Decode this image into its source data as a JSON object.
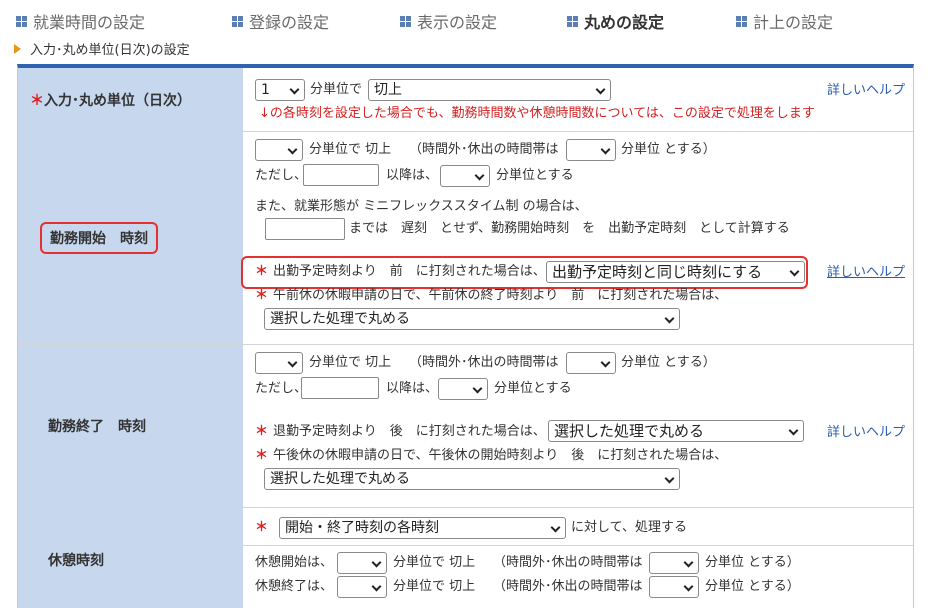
{
  "tabs": [
    {
      "label": "就業時間の設定"
    },
    {
      "label": "登録の設定"
    },
    {
      "label": "表示の設定"
    },
    {
      "label": "丸めの設定"
    },
    {
      "label": "計上の設定"
    }
  ],
  "breadcrumb": "入力･丸め単位(日次)の設定",
  "required_mark": "＊",
  "colors": {
    "accent": "#2f63b0",
    "label_bg": "#c6d7ee",
    "highlight": "#e53030",
    "required": "#e02020",
    "link": "#2a5db0"
  },
  "row_input_unit": {
    "label": "入力･丸め単位（日次）",
    "unit_select": "1",
    "unit_text": "分単位で",
    "method_select": "切上",
    "help_link": "詳しいヘルプ",
    "note": "↓の各時刻を設定した場合でも、勤務時間数や休憩時間数については、この設定で処理をします"
  },
  "row_start": {
    "label": "勤務開始　時刻",
    "line1_unit": "分単位で",
    "line1_method": "切上",
    "line1_mid": "（時間外･休出の時間帯は",
    "line1_end": "分単位 とする）",
    "line2_pre": "ただし、",
    "line2_mid": "以降は、",
    "line2_end": "分単位とする",
    "flex_line": "また、就業形態が ミニフレックススタイム制 の場合は、",
    "flex_line2": "までは　遅刻　とせず、勤務開始時刻　を　出勤予定時刻　として計算する",
    "before_label": "出勤予定時刻より　前　に打刻された場合は、",
    "before_select": "出勤予定時刻と同じ時刻にする",
    "help_link": "詳しいヘルプ",
    "am_leave_label": "午前休の休暇申請の日で、午前休の終了時刻より　前　に打刻された場合は、",
    "am_leave_select": "選択した処理で丸める"
  },
  "row_end": {
    "label": "勤務終了　時刻",
    "line1_unit": "分単位で",
    "line1_method": "切上",
    "line1_mid": "（時間外･休出の時間帯は",
    "line1_end": "分単位 とする）",
    "line2_pre": "ただし、",
    "line2_mid": "以降は、",
    "line2_end": "分単位とする",
    "after_label": "退勤予定時刻より　後　に打刻された場合は、",
    "after_select": "選択した処理で丸める",
    "help_link": "詳しいヘルプ",
    "pm_leave_label": "午後休の休暇申請の日で、午後休の開始時刻より　後　に打刻された場合は、",
    "pm_leave_select": "選択した処理で丸める"
  },
  "row_break": {
    "label": "休憩時刻",
    "target_select": "開始・終了時刻の各時刻",
    "target_text": "に対して、処理する",
    "start_pre": "休憩開始は、",
    "end_pre": "休憩終了は、",
    "unit": "分単位で",
    "method": "切上",
    "mid": "（時間外･休出の時間帯は",
    "end": "分単位 とする）"
  }
}
